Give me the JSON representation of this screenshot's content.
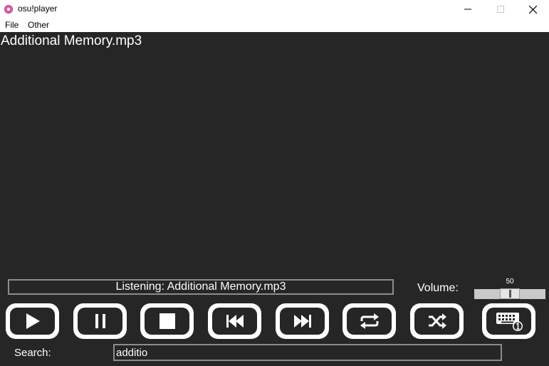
{
  "window": {
    "title": "osu!player"
  },
  "menu": {
    "items": [
      "File",
      "Other"
    ]
  },
  "now_playing": {
    "title": "Additional Memory.mp3"
  },
  "status": {
    "text": "Listening: Additional Memory.mp3"
  },
  "volume": {
    "label": "Volume:",
    "value": "50",
    "level_percent": 50
  },
  "controls": {
    "buttons": [
      {
        "name": "play",
        "icon": "play-icon"
      },
      {
        "name": "pause",
        "icon": "pause-icon"
      },
      {
        "name": "stop",
        "icon": "stop-icon"
      },
      {
        "name": "previous",
        "icon": "skip-previous-icon"
      },
      {
        "name": "next",
        "icon": "skip-next-icon"
      },
      {
        "name": "repeat",
        "icon": "repeat-icon"
      },
      {
        "name": "shuffle",
        "icon": "shuffle-icon"
      },
      {
        "name": "hotkeys",
        "icon": "keyboard-icon"
      }
    ]
  },
  "search": {
    "label": "Search:",
    "value": "additio"
  },
  "colors": {
    "background": "#262626",
    "button_face": "#ffffff",
    "border": "#8c8c8c",
    "text": "#ffffff"
  }
}
